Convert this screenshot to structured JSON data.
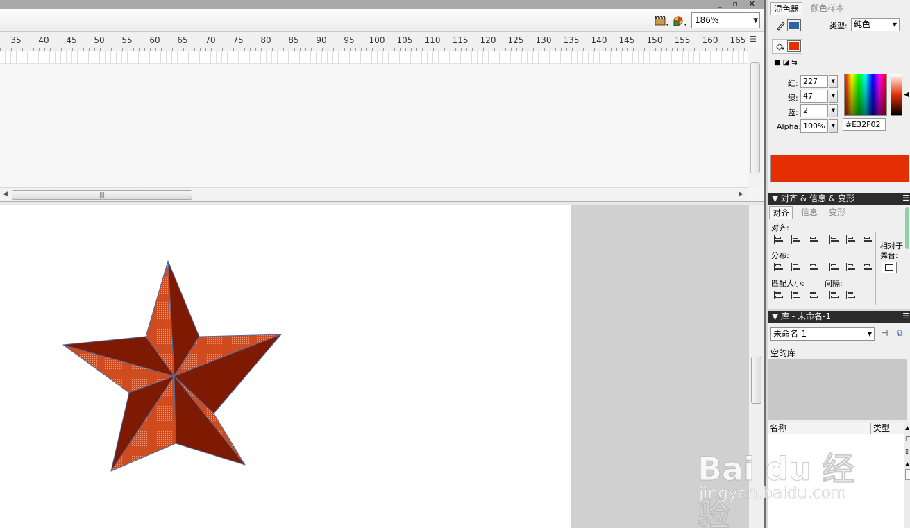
{
  "toolbar": {
    "zoom": "186%",
    "icons": [
      "edit-scene-icon",
      "edit-symbol-icon"
    ]
  },
  "timeline": {
    "ruler_labels": [
      "35",
      "40",
      "45",
      "50",
      "55",
      "60",
      "65",
      "70",
      "75",
      "80",
      "85",
      "90",
      "95",
      "100",
      "105",
      "110",
      "115",
      "120",
      "125",
      "130",
      "135",
      "140",
      "145",
      "150",
      "155",
      "160",
      "165"
    ]
  },
  "color_mixer": {
    "tabs": [
      "混色器",
      "颜色样本"
    ],
    "type_label": "类型:",
    "type_value": "纯色",
    "stroke_color": "#2f63a8",
    "fill_color": "#E32F02",
    "red_label": "红:",
    "red": "227",
    "green_label": "绿:",
    "green": "47",
    "blue_label": "蓝:",
    "blue": "2",
    "alpha_label": "Alpha:",
    "alpha": "100%",
    "hex": "#E32F02"
  },
  "align_panel": {
    "title": "▼ 对齐 & 信息 & 变形",
    "tabs": [
      "对齐",
      "信息",
      "变形"
    ],
    "align_label": "对齐:",
    "distribute_label": "分布:",
    "match_size_label": "匹配大小:",
    "spacing_label": "间隔:",
    "relative_label_1": "相对于",
    "relative_label_2": "舞台:"
  },
  "library": {
    "title": "▼ 库 - 未命名-1",
    "selected": "未命名-1",
    "empty_text": "空的库",
    "col_name": "名称",
    "col_type": "类型"
  },
  "watermark": {
    "line1": "Bai du 经验",
    "line2": "jingyan.baidu.com"
  },
  "stage": {
    "star_dark": "#7e1a02",
    "star_light": "#cf4a1d",
    "stroke": "#4a6da0"
  }
}
